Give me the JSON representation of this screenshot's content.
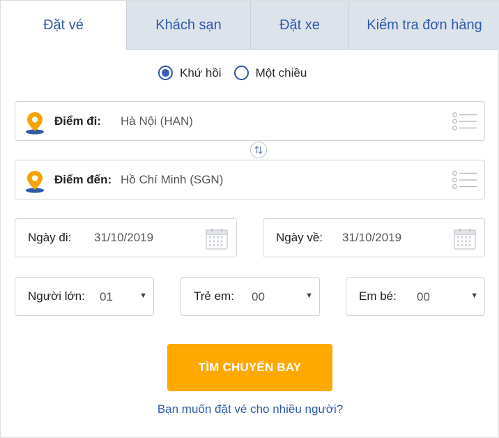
{
  "tabs": [
    {
      "label": "Đặt vé",
      "active": true
    },
    {
      "label": "Khách sạn",
      "active": false
    },
    {
      "label": "Đặt xe",
      "active": false
    },
    {
      "label": "Kiểm tra đơn hàng",
      "active": false
    }
  ],
  "trip_type": {
    "round_trip": "Khứ hồi",
    "one_way": "Một chiều",
    "selected": "round_trip"
  },
  "origin": {
    "label": "Điểm đi:",
    "value": "Hà Nội (HAN)",
    "icon": "location-pin-icon"
  },
  "destination": {
    "label": "Điểm đến:",
    "value": "Hồ Chí Minh (SGN)",
    "icon": "location-pin-icon"
  },
  "departure_date": {
    "label": "Ngày đi:",
    "value": "31/10/2019",
    "icon": "calendar-icon"
  },
  "return_date": {
    "label": "Ngày về:",
    "value": "31/10/2019",
    "icon": "calendar-icon"
  },
  "passengers": {
    "adults": {
      "label": "Người lớn:",
      "value": "01"
    },
    "children": {
      "label": "Trẻ em:",
      "value": "00"
    },
    "infants": {
      "label": "Em bé:",
      "value": "00"
    }
  },
  "search_button": "TÌM CHUYẾN BAY",
  "multi_passenger_link": "Bạn muốn đặt vé cho nhiều người?",
  "colors": {
    "accent_blue": "#2e5aa8",
    "button_orange": "#ffa800",
    "pin_orange": "#f5a300",
    "tab_inactive_bg": "#dde3ea"
  }
}
